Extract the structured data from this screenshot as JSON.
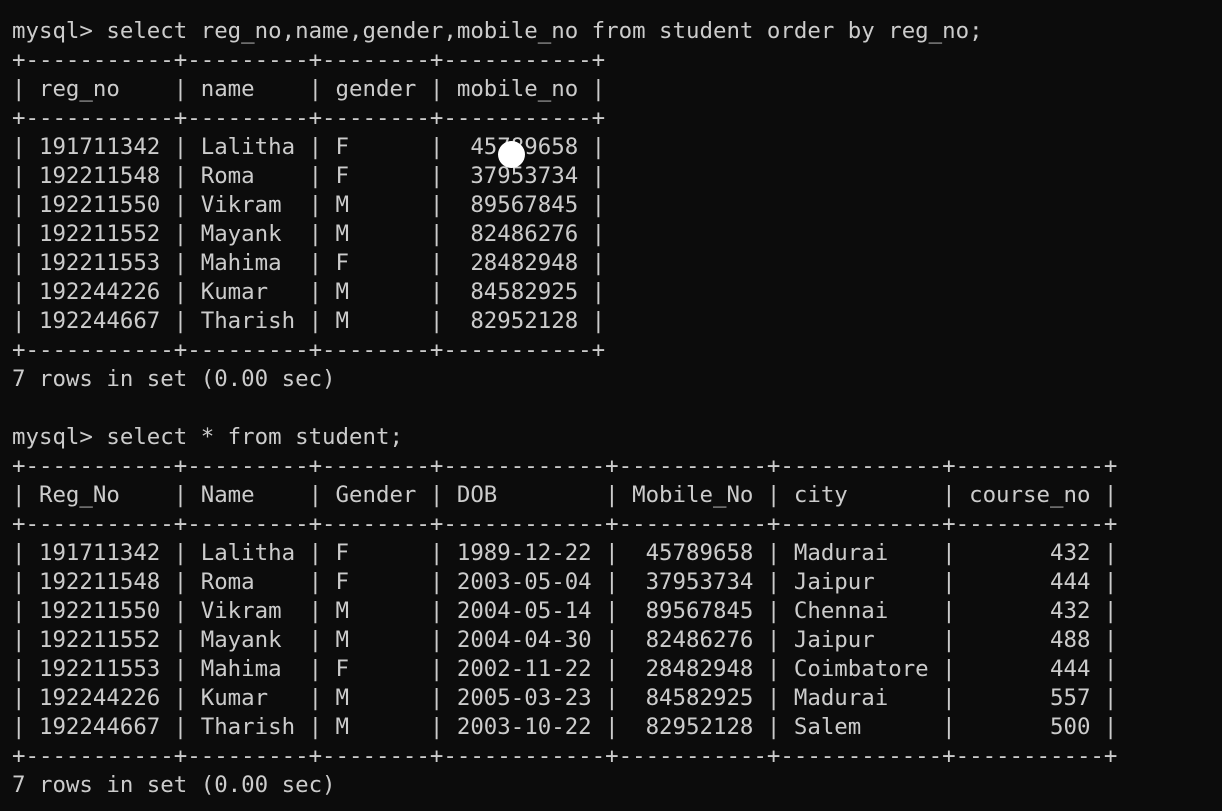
{
  "terminal": {
    "lines": [
      "mysql> select reg_no,name,gender,mobile_no from student order by reg_no;",
      "+-----------+---------+--------+-----------+",
      "| reg_no    | name    | gender | mobile_no |",
      "+-----------+---------+--------+-----------+",
      "| 191711342 | Lalitha | F      |  45789658 |",
      "| 192211548 | Roma    | F      |  37953734 |",
      "| 192211550 | Vikram  | M      |  89567845 |",
      "| 192211552 | Mayank  | M      |  82486276 |",
      "| 192211553 | Mahima  | F      |  28482948 |",
      "| 192244226 | Kumar   | M      |  84582925 |",
      "| 192244667 | Tharish | M      |  82952128 |",
      "+-----------+---------+--------+-----------+",
      "7 rows in set (0.00 sec)",
      "",
      "mysql> select * from student;",
      "+-----------+---------+--------+------------+-----------+------------+-----------+",
      "| Reg_No    | Name    | Gender | DOB        | Mobile_No | city       | course_no |",
      "+-----------+---------+--------+------------+-----------+------------+-----------+",
      "| 191711342 | Lalitha | F      | 1989-12-22 |  45789658 | Madurai    |       432 |",
      "| 192211548 | Roma    | F      | 2003-05-04 |  37953734 | Jaipur     |       444 |",
      "| 192211550 | Vikram  | M      | 2004-05-14 |  89567845 | Chennai    |       432 |",
      "| 192211552 | Mayank  | M      | 2004-04-30 |  82486276 | Jaipur     |       488 |",
      "| 192211553 | Mahima  | F      | 2002-11-22 |  28482948 | Coimbatore |       444 |",
      "| 192244226 | Kumar   | M      | 2005-03-23 |  84582925 | Madurai    |       557 |",
      "| 192244667 | Tharish | M      | 2003-10-22 |  82952128 | Salem      |       500 |",
      "+-----------+---------+--------+------------+-----------+------------+-----------+",
      "7 rows in set (0.00 sec)"
    ]
  },
  "colors": {
    "background": "#0c0c0c",
    "text": "#cccccc",
    "cursor": "#ffffff"
  }
}
